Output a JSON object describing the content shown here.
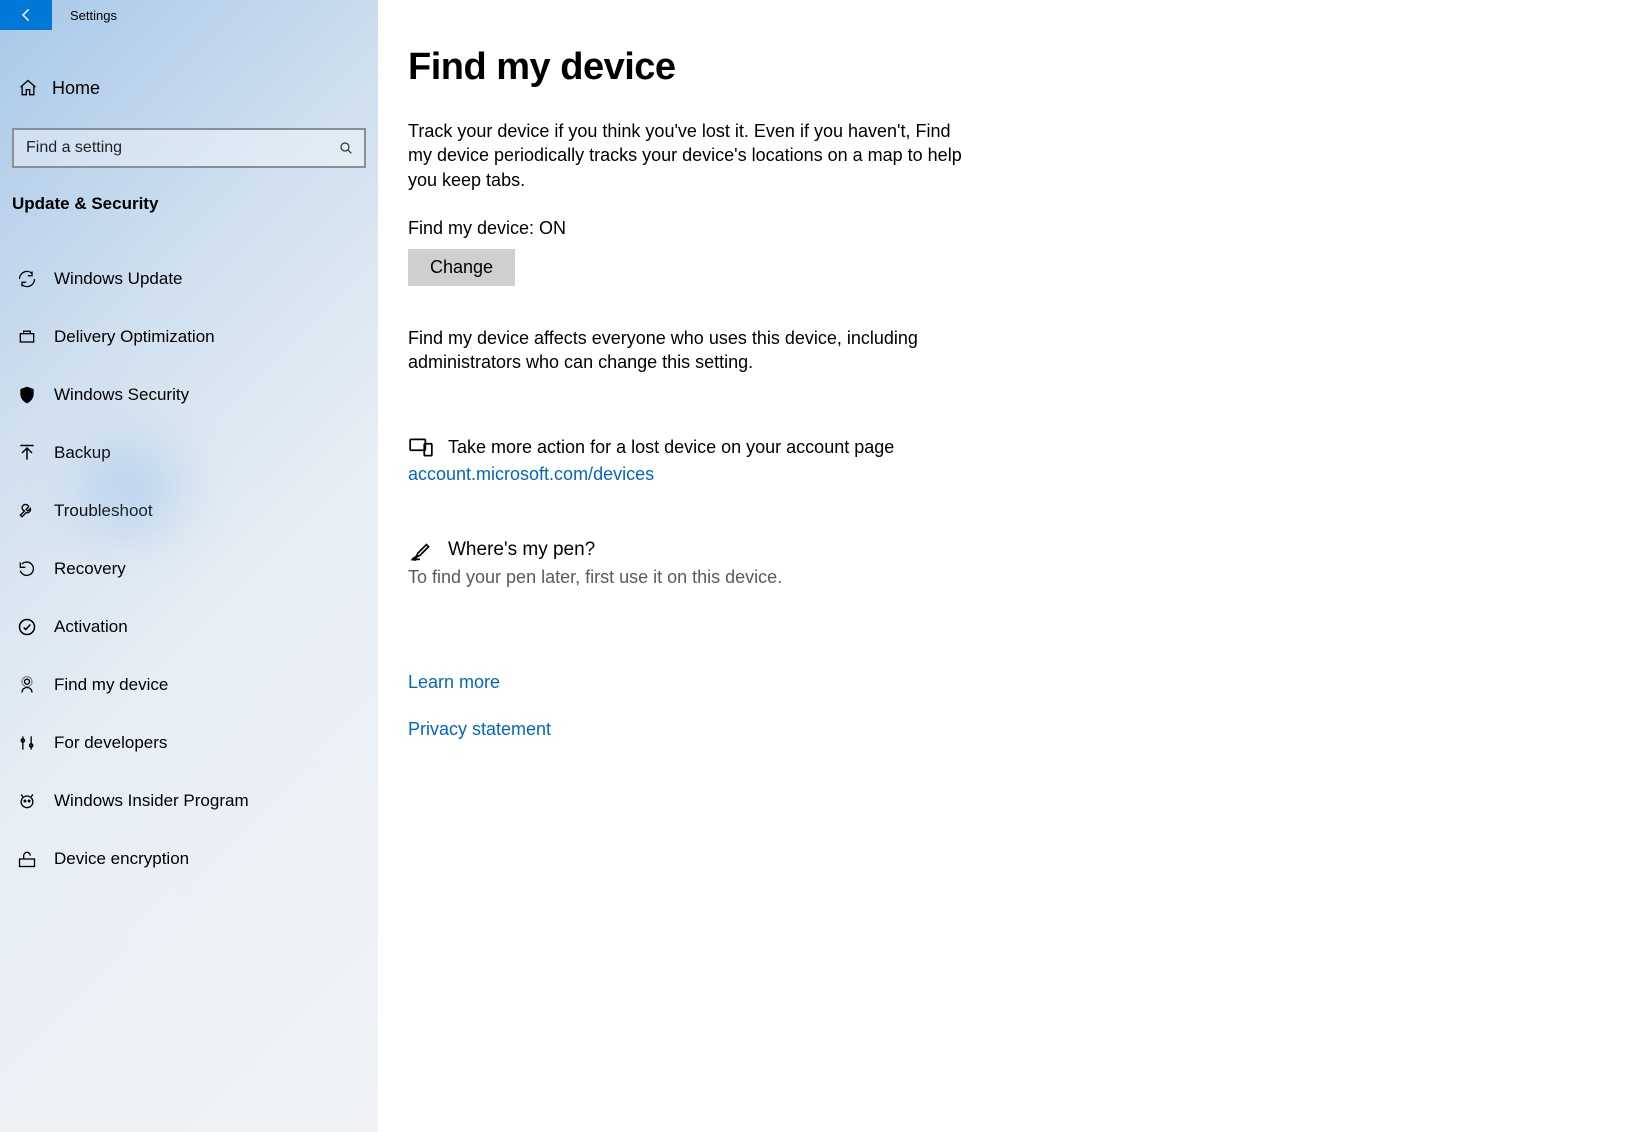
{
  "app": {
    "title": "Settings"
  },
  "sidebar": {
    "home_label": "Home",
    "search_placeholder": "Find a setting",
    "section_title": "Update & Security",
    "items": [
      {
        "id": "windows-update",
        "label": "Windows Update",
        "icon": "refresh-icon"
      },
      {
        "id": "delivery-optimization",
        "label": "Delivery Optimization",
        "icon": "delivery-icon"
      },
      {
        "id": "windows-security",
        "label": "Windows Security",
        "icon": "shield-icon"
      },
      {
        "id": "backup",
        "label": "Backup",
        "icon": "backup-icon"
      },
      {
        "id": "troubleshoot",
        "label": "Troubleshoot",
        "icon": "wrench-icon"
      },
      {
        "id": "recovery",
        "label": "Recovery",
        "icon": "recovery-icon"
      },
      {
        "id": "activation",
        "label": "Activation",
        "icon": "check-circle-icon"
      },
      {
        "id": "find-my-device",
        "label": "Find my device",
        "icon": "locate-icon"
      },
      {
        "id": "for-developers",
        "label": "For developers",
        "icon": "tools-icon"
      },
      {
        "id": "insider-program",
        "label": "Windows Insider Program",
        "icon": "insider-icon"
      },
      {
        "id": "device-encryption",
        "label": "Device encryption",
        "icon": "lock-icon"
      }
    ]
  },
  "page": {
    "title": "Find my device",
    "intro": "Track your device if you think you've lost it. Even if you haven't, Find my device periodically tracks your device's locations on a map to help you keep tabs.",
    "status_label": "Find my device: ON",
    "change_button": "Change",
    "note": "Find my device affects everyone who uses this device, including administrators who can change this setting.",
    "action_text": "Take more action for a lost device on your account page",
    "action_link": "account.microsoft.com/devices",
    "pen_title": "Where's my pen?",
    "pen_sub": "To find your pen later, first use it on this device.",
    "learn_more": "Learn more",
    "privacy": "Privacy statement"
  }
}
